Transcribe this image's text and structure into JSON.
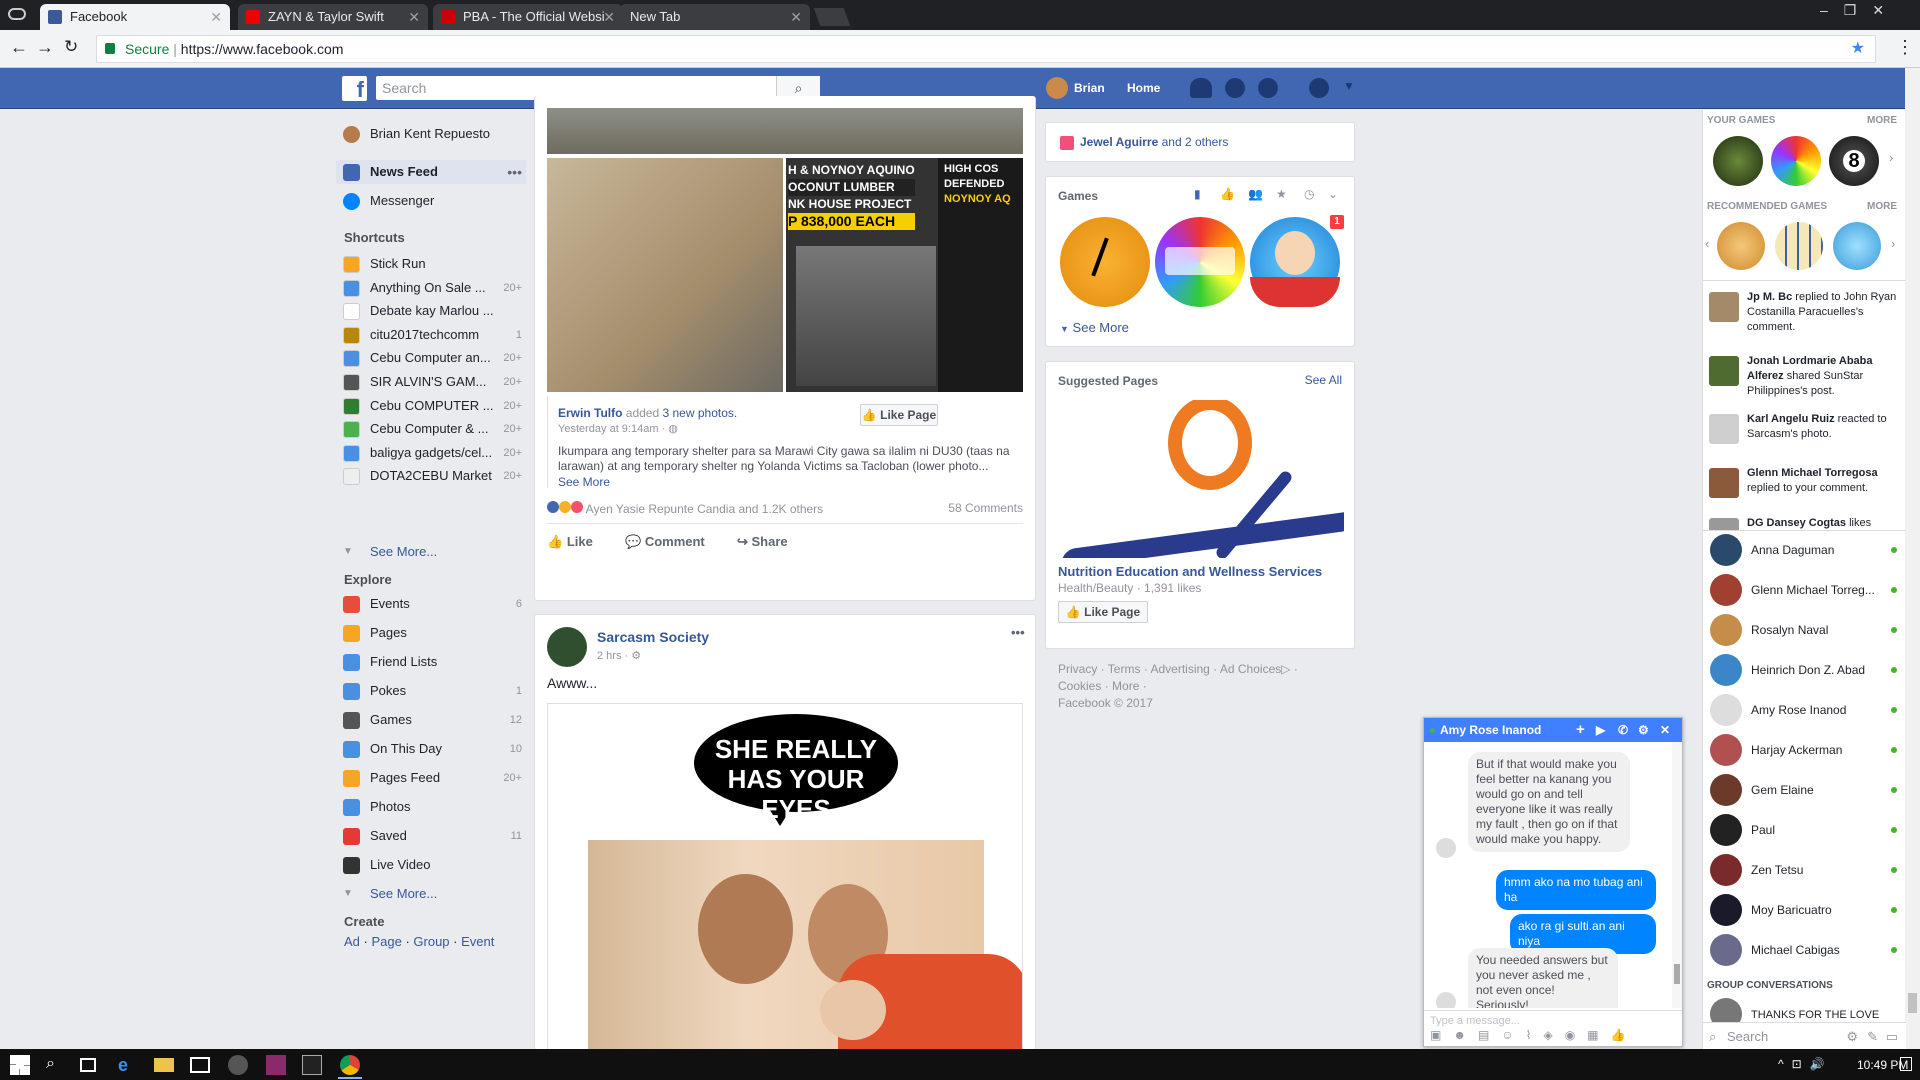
{
  "browser": {
    "tabs": [
      {
        "title": "Facebook"
      },
      {
        "title": "ZAYN & Taylor Swift"
      },
      {
        "title": "PBA - The Official Websi"
      },
      {
        "title": "New Tab"
      }
    ],
    "secure": "Secure",
    "url": "https://www.facebook.com"
  },
  "fb": {
    "search_placeholder": "Search",
    "user": "Brian",
    "home": "Home"
  },
  "left": {
    "profile": "Brian Kent Repuesto",
    "news_feed": "News Feed",
    "messenger": "Messenger",
    "shortcuts_header": "Shortcuts",
    "shortcuts": [
      {
        "label": "Stick Run",
        "count": ""
      },
      {
        "label": "Anything On Sale ...",
        "count": "20+"
      },
      {
        "label": "Debate kay Marlou ...",
        "count": ""
      },
      {
        "label": "citu2017techcomm",
        "count": "1"
      },
      {
        "label": "Cebu Computer an...",
        "count": "20+"
      },
      {
        "label": "SIR ALVIN'S GAM...",
        "count": "20+"
      },
      {
        "label": "Cebu COMPUTER ...",
        "count": "20+"
      },
      {
        "label": "Cebu Computer & ...",
        "count": "20+"
      },
      {
        "label": "baligya gadgets/cel...",
        "count": "20+"
      },
      {
        "label": "DOTA2CEBU Market",
        "count": "20+"
      }
    ],
    "see_more": "See More...",
    "explore_header": "Explore",
    "explore": [
      {
        "label": "Events",
        "count": "6"
      },
      {
        "label": "Pages",
        "count": ""
      },
      {
        "label": "Friend Lists",
        "count": ""
      },
      {
        "label": "Pokes",
        "count": "1"
      },
      {
        "label": "Games",
        "count": "12"
      },
      {
        "label": "On This Day",
        "count": "10"
      },
      {
        "label": "Pages Feed",
        "count": "20+"
      },
      {
        "label": "Photos",
        "count": ""
      },
      {
        "label": "Saved",
        "count": "11"
      },
      {
        "label": "Live Video",
        "count": ""
      }
    ],
    "see_more2": "See More...",
    "create_header": "Create",
    "create": [
      "Ad",
      "Page",
      "Group",
      "Event"
    ]
  },
  "post1": {
    "photo_text": {
      "l1": "H & NOYNOY AQUINO",
      "l2": "OCONUT LUMBER",
      "l3": "NK HOUSE PROJECT",
      "l4": "P 838,000 EACH",
      "r1": "HIGH COS",
      "r2": "DEFENDED",
      "r3": "NOYNOY AQ"
    },
    "author": "Erwin Tulfo",
    "added": "added",
    "photos_link": "3 new photos.",
    "time": "Yesterday at 9:14am · ",
    "like_page": "Like Page",
    "text": "Ikumpara ang temporary shelter para sa Marawi City gawa sa ilalim ni DU30 (taas na larawan) at ang temporary shelter ng Yolanda Victims sa Tacloban (lower photo...",
    "see_more": "See More",
    "reactions": "Ayen Yasie Repunte Candia and 1.2K others",
    "comments": "58 Comments",
    "actions": [
      "Like",
      "Comment",
      "Share"
    ]
  },
  "post2": {
    "author": "Sarcasm Society",
    "time": "2 hrs · ",
    "text": "Awww...",
    "meme": "SHE REALLY HAS YOUR EYES"
  },
  "right": {
    "bday_name": "Jewel Aguirre",
    "bday_rest": " and 2 others",
    "games_header": "Games",
    "see_more": "See More",
    "game_badge": "1",
    "suggested_header": "Suggested Pages",
    "see_all": "See All",
    "page_name": "Nutrition Education and Wellness Services",
    "page_meta": "Health/Beauty · 1,391 likes",
    "like_page": "Like Page",
    "footer": [
      "Privacy",
      "Terms",
      "Advertising",
      "Ad Choices",
      "Cookies",
      "More"
    ],
    "copyright": "Facebook © 2017"
  },
  "ticker": {
    "your_games": "YOUR GAMES",
    "more": "MORE",
    "recommended": "RECOMMENDED GAMES",
    "items": [
      {
        "name": "Jp M. Bc",
        "rest": " replied to John Ryan Costanilla Paracuelles's comment."
      },
      {
        "name": "Jonah Lordmarie Ababa Alferez",
        "rest": " shared SunStar Philippines's post."
      },
      {
        "name": "Karl Angelu Ruiz",
        "rest": " reacted to Sarcasm's photo."
      },
      {
        "name": "Glenn Michael Torregosa",
        "rest": " replied to your comment."
      },
      {
        "name": "DG Dansey Cogtas",
        "rest": " likes"
      }
    ],
    "contacts": [
      "Anna Daguman",
      "Glenn Michael Torreg...",
      "Rosalyn Naval",
      "Heinrich Don Z. Abad",
      "Amy Rose Inanod",
      "Harjay Ackerman",
      "Gem Elaine",
      "Paul",
      "Zen Tetsu",
      "Moy Baricuatro",
      "Michael Cabigas"
    ],
    "group_header": "GROUP CONVERSATIONS",
    "group1": "THANKS FOR THE LOVE",
    "search": "Search"
  },
  "chat": {
    "name": "Amy Rose Inanod",
    "messages": [
      {
        "text": "But if that would make you feel better na kanang you would go on and tell everyone like it was really my fault , then go on if that would make you happy."
      },
      {
        "text": "hmm ako na mo tubag ani ha"
      },
      {
        "text": "ako ra gi sulti.an ani niya"
      },
      {
        "text": "You needed answers but you never asked me , not even once! Seriously!"
      }
    ],
    "placeholder": "Type a message..."
  },
  "taskbar": {
    "time": "10:49 PM"
  }
}
